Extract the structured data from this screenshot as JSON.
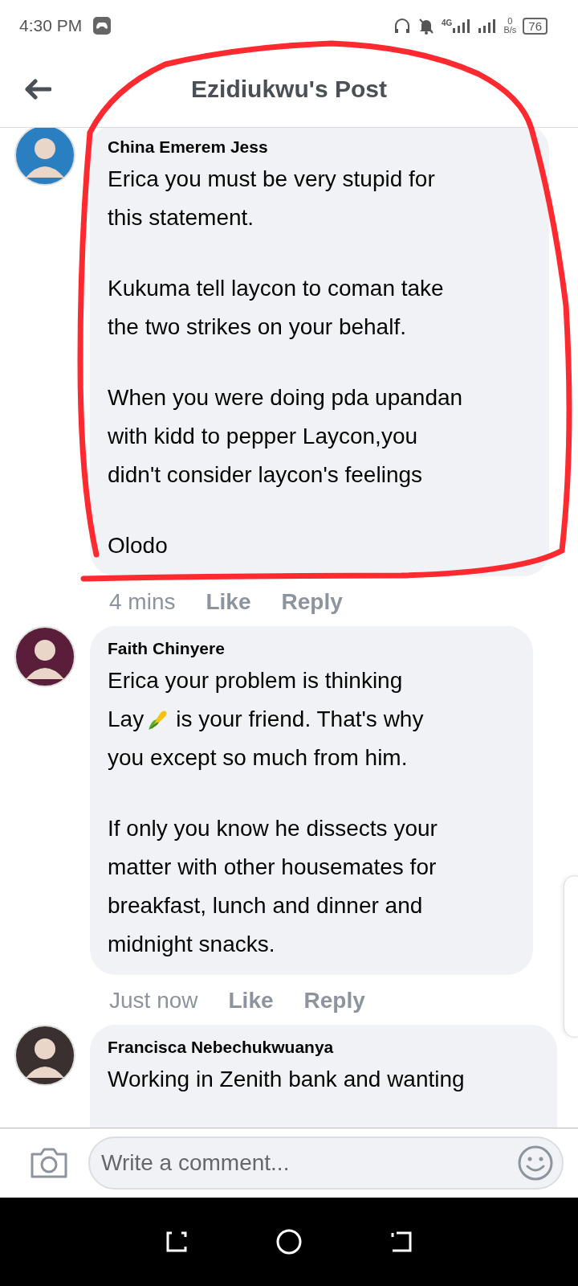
{
  "status_bar": {
    "time": "4:30 PM",
    "network": "4G",
    "speed_value": "0",
    "speed_unit": "B/s",
    "battery": "76"
  },
  "header": {
    "title": "Ezidiukwu's Post"
  },
  "comments": [
    {
      "author": "China Emerem Jess",
      "paragraphs": [
        [
          [
            {
              "text": "Erica you must be very stupid for"
            }
          ],
          [
            {
              "text": "this statement."
            }
          ]
        ],
        [
          [
            {
              "text": "Kukuma tell laycon to coman take"
            }
          ],
          [
            {
              "text": "the two strikes on your behalf."
            }
          ]
        ],
        [
          [
            {
              "text": "When you were doing pda upandan"
            }
          ],
          [
            {
              "text": "with kidd to pepper Laycon,you"
            }
          ],
          [
            {
              "text": "didn't consider laycon's feelings"
            }
          ]
        ],
        [
          [
            {
              "text": "Olodo"
            }
          ]
        ]
      ],
      "time": "4 mins",
      "like": "Like",
      "reply": "Reply"
    },
    {
      "author": "Faith Chinyere",
      "paragraphs": [
        [
          [
            {
              "text": "Erica your problem is thinking"
            }
          ],
          [
            {
              "text": "Lay"
            },
            {
              "kind": "corn"
            },
            {
              "text": "is your friend. That's why"
            }
          ],
          [
            {
              "text": "you except so much from him."
            }
          ]
        ],
        [
          [
            {
              "text": "If only you know he dissects your"
            }
          ],
          [
            {
              "text": "matter with other housemates for"
            }
          ],
          [
            {
              "text": "breakfast, lunch and dinner and"
            }
          ],
          [
            {
              "text": "midnight snacks."
            }
          ]
        ]
      ],
      "time": "Just now",
      "like": "Like",
      "reply": "Reply"
    },
    {
      "author": "Francisca Nebechukwuanya",
      "paragraphs": [
        [
          [
            {
              "text": "Working in Zenith bank and wanting"
            }
          ]
        ]
      ]
    }
  ],
  "composer": {
    "placeholder": "Write a comment..."
  }
}
